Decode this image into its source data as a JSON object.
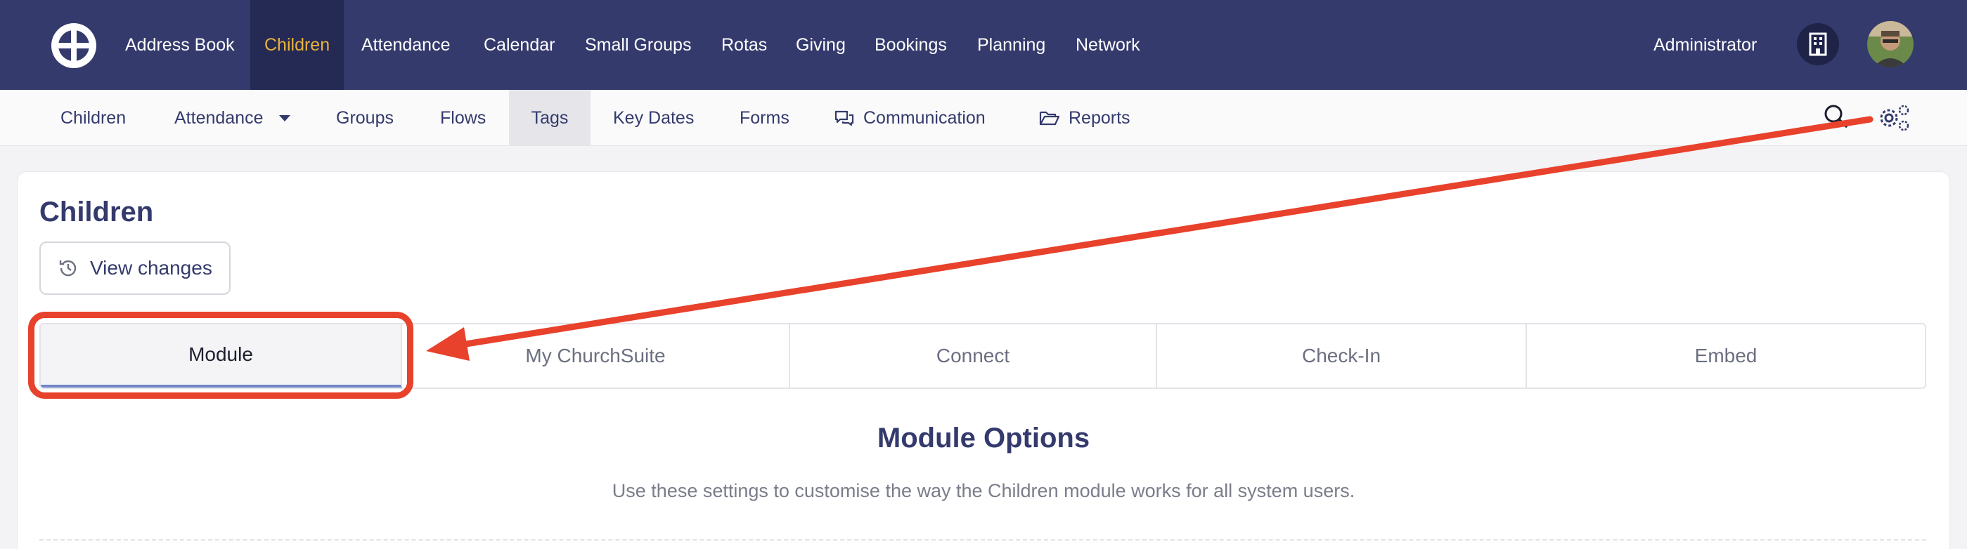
{
  "topnav": {
    "items": [
      {
        "label": "Address Book"
      },
      {
        "label": "Children",
        "active": true
      },
      {
        "label": "Attendance"
      },
      {
        "label": "Calendar"
      },
      {
        "label": "Small Groups"
      },
      {
        "label": "Rotas"
      },
      {
        "label": "Giving"
      },
      {
        "label": "Bookings"
      },
      {
        "label": "Planning"
      },
      {
        "label": "Network"
      }
    ],
    "user_label": "Administrator",
    "logo_icon": "churchsuite-logo-icon",
    "building_icon": "building-icon"
  },
  "subnav": {
    "items": [
      {
        "label": "Children"
      },
      {
        "label": "Attendance",
        "dropdown": true
      },
      {
        "label": "Groups"
      },
      {
        "label": "Flows"
      },
      {
        "label": "Tags",
        "active": true
      },
      {
        "label": "Key Dates"
      },
      {
        "label": "Forms"
      },
      {
        "label": "Communication",
        "icon": "chat-icon"
      },
      {
        "label": "Reports",
        "icon": "folder-open-icon"
      }
    ],
    "search_icon": "search-icon",
    "settings_icon": "gears-icon"
  },
  "page": {
    "title": "Children",
    "view_changes_label": "View changes"
  },
  "tabs": [
    {
      "label": "Module",
      "active": true
    },
    {
      "label": "My ChurchSuite"
    },
    {
      "label": "Connect"
    },
    {
      "label": "Check-In"
    },
    {
      "label": "Embed"
    }
  ],
  "section": {
    "title": "Module Options",
    "description": "Use these settings to customise the way the Children module works for all system users."
  },
  "colors": {
    "topbar": "#343a6c",
    "active_nav": "#e8b23c",
    "annotation": "#e8412c",
    "tab_underline": "#6f87c9"
  }
}
